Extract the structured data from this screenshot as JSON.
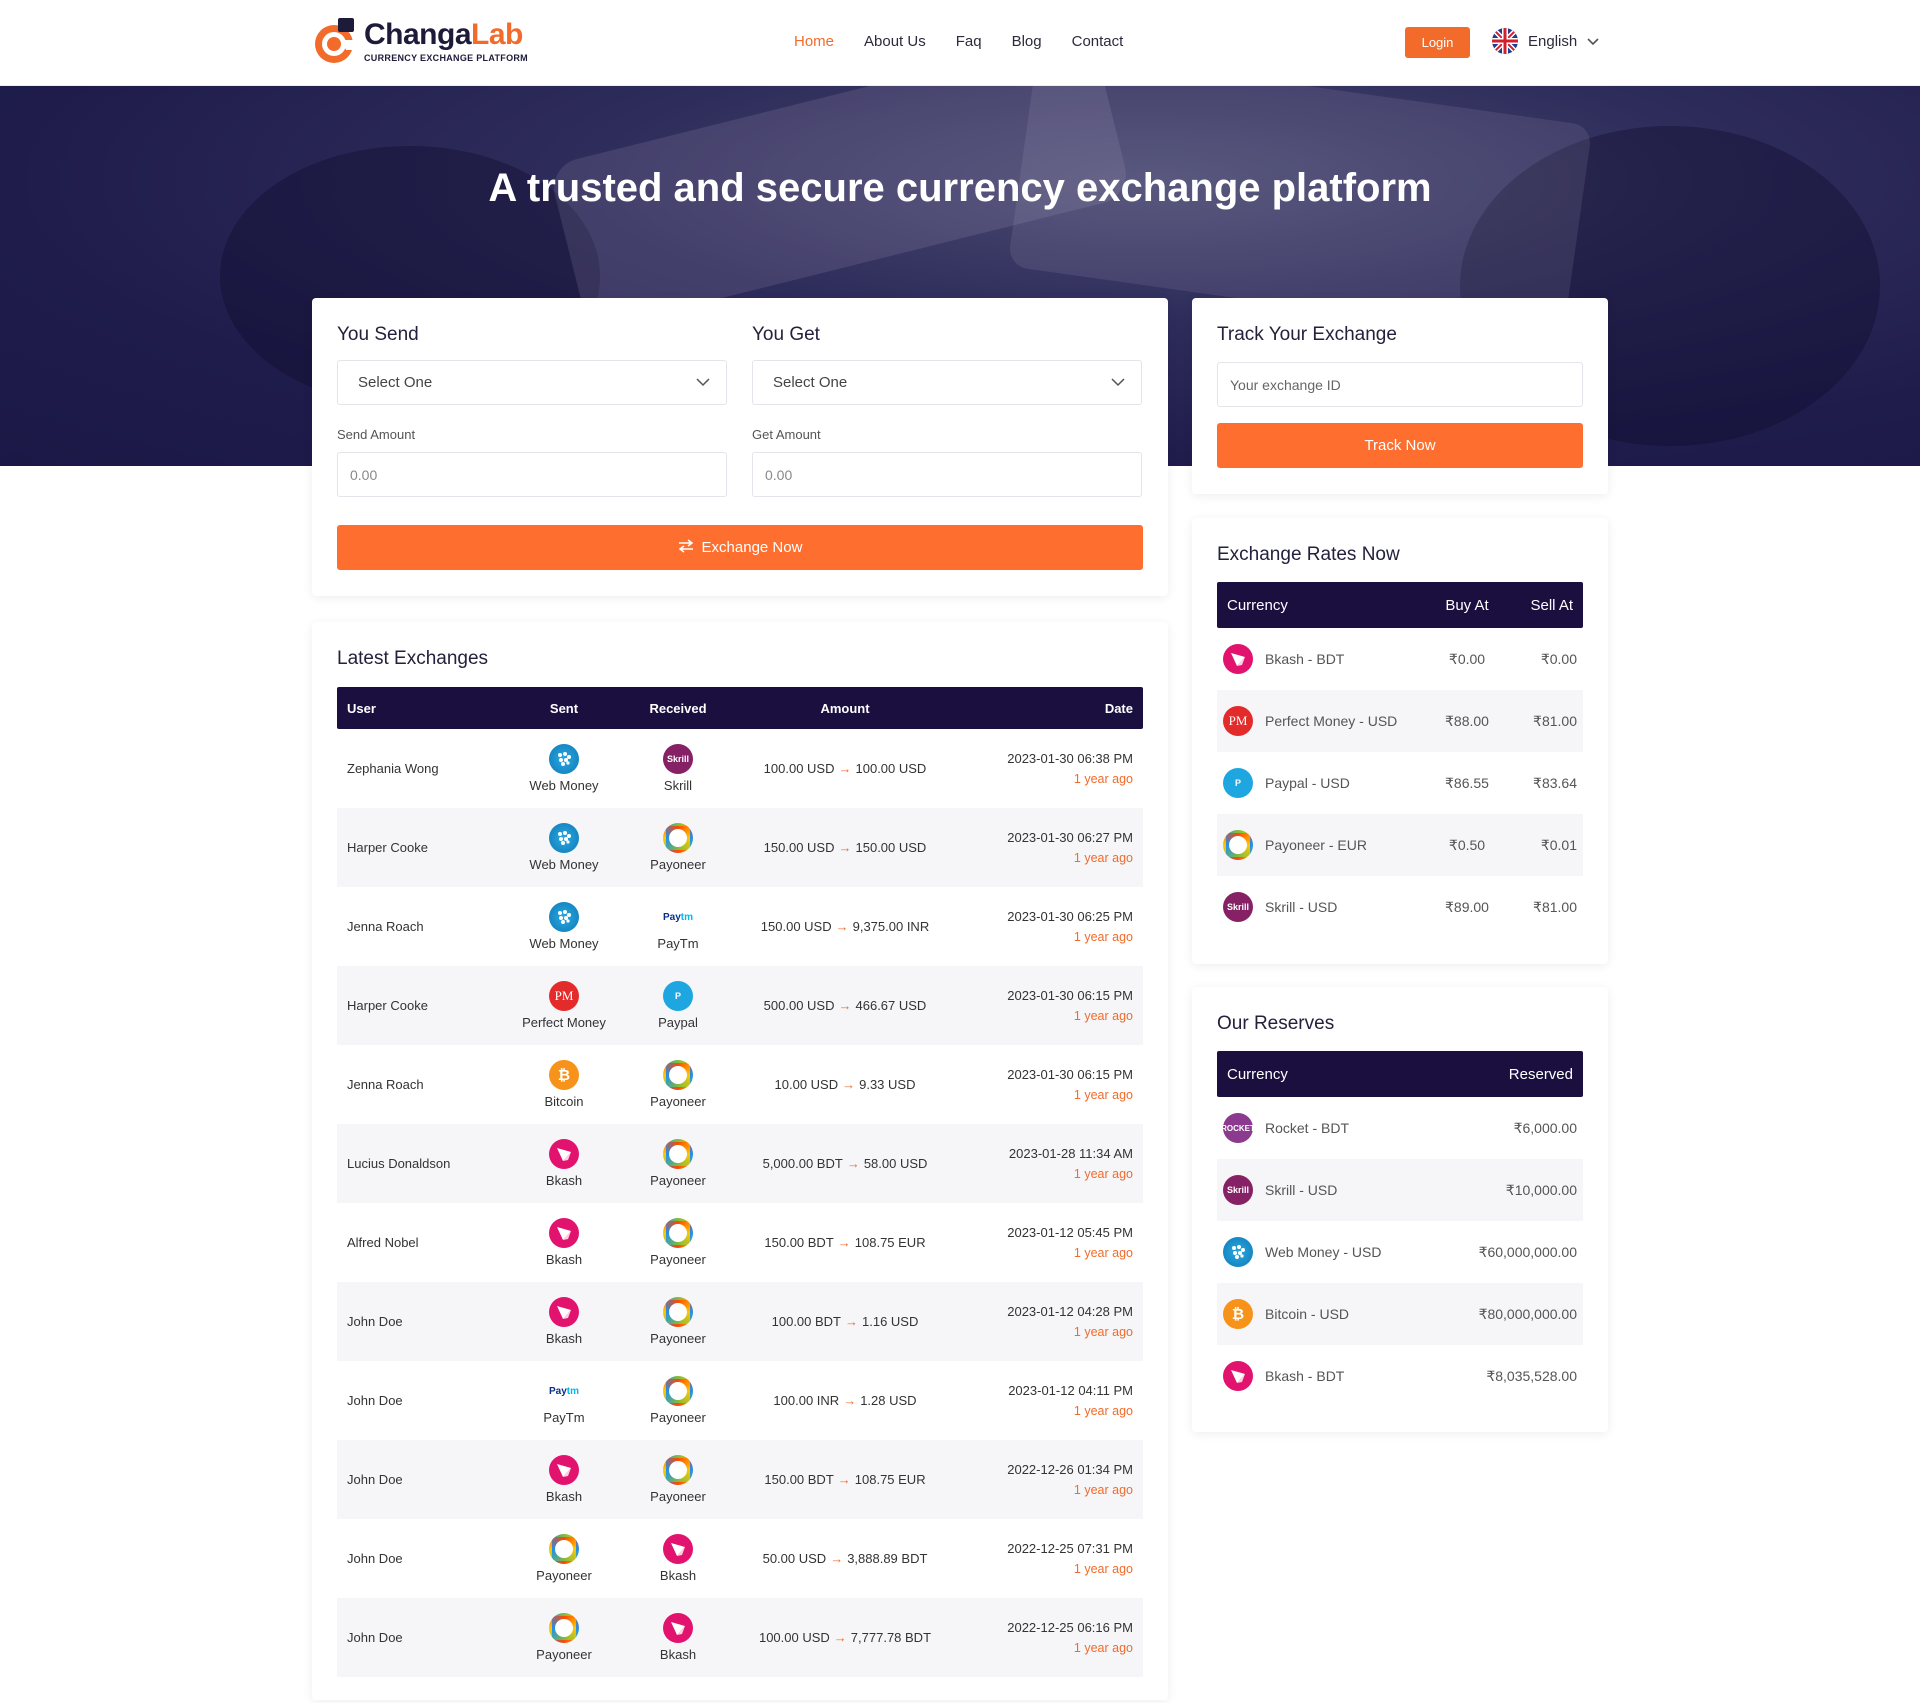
{
  "header": {
    "logo_name_1": "Changa",
    "logo_name_2": "Lab",
    "logo_tagline": "CURRENCY EXCHANGE PLATFORM",
    "nav": [
      "Home",
      "About Us",
      "Faq",
      "Blog",
      "Contact"
    ],
    "login_label": "Login",
    "language": "English"
  },
  "hero": {
    "title": "A trusted and secure currency exchange platform"
  },
  "exchange_form": {
    "send_title": "You Send",
    "get_title": "You Get",
    "send_select": "Select One",
    "get_select": "Select One",
    "send_amount_label": "Send Amount",
    "get_amount_label": "Get Amount",
    "send_amount_placeholder": "0.00",
    "get_amount_placeholder": "0.00",
    "button_label": "Exchange Now"
  },
  "track": {
    "title": "Track Your Exchange",
    "placeholder": "Your exchange ID",
    "button_label": "Track Now"
  },
  "rates": {
    "title": "Exchange Rates Now",
    "headers": [
      "Currency",
      "Buy At",
      "Sell At"
    ],
    "rows": [
      {
        "icon": "bkash-icon",
        "currency": "Bkash - BDT",
        "buy": "₹0.00",
        "sell": "₹0.00"
      },
      {
        "icon": "perfect-money-icon",
        "currency": "Perfect Money - USD",
        "buy": "₹88.00",
        "sell": "₹81.00"
      },
      {
        "icon": "paypal-icon",
        "currency": "Paypal - USD",
        "buy": "₹86.55",
        "sell": "₹83.64"
      },
      {
        "icon": "payoneer-icon",
        "currency": "Payoneer - EUR",
        "buy": "₹0.50",
        "sell": "₹0.01"
      },
      {
        "icon": "skrill-icon",
        "currency": "Skrill - USD",
        "buy": "₹89.00",
        "sell": "₹81.00"
      }
    ]
  },
  "reserves": {
    "title": "Our Reserves",
    "headers": [
      "Currency",
      "Reserved"
    ],
    "rows": [
      {
        "icon": "rocket-icon",
        "currency": "Rocket - BDT",
        "amount": "₹6,000.00"
      },
      {
        "icon": "skrill-icon",
        "currency": "Skrill - USD",
        "amount": "₹10,000.00"
      },
      {
        "icon": "webmoney-icon",
        "currency": "Web Money - USD",
        "amount": "₹60,000,000.00"
      },
      {
        "icon": "bitcoin-icon",
        "currency": "Bitcoin - USD",
        "amount": "₹80,000,000.00"
      },
      {
        "icon": "bkash-icon",
        "currency": "Bkash - BDT",
        "amount": "₹8,035,528.00"
      }
    ]
  },
  "latest": {
    "title": "Latest Exchanges",
    "headers": [
      "User",
      "Sent",
      "Received",
      "Amount",
      "Date"
    ],
    "rows": [
      {
        "user": "Zephania Wong",
        "sent": "Web Money",
        "sent_icon": "webmoney",
        "received": "Skrill",
        "received_icon": "skrill",
        "from": "100.00 USD",
        "to": "100.00 USD",
        "date": "2023-01-30 06:38 PM",
        "ago": "1 year ago"
      },
      {
        "user": "Harper Cooke",
        "sent": "Web Money",
        "sent_icon": "webmoney",
        "received": "Payoneer",
        "received_icon": "payoneer",
        "from": "150.00 USD",
        "to": "150.00 USD",
        "date": "2023-01-30 06:27 PM",
        "ago": "1 year ago"
      },
      {
        "user": "Jenna Roach",
        "sent": "Web Money",
        "sent_icon": "webmoney",
        "received": "PayTm",
        "received_icon": "paytm",
        "from": "150.00 USD",
        "to": "9,375.00 INR",
        "date": "2023-01-30 06:25 PM",
        "ago": "1 year ago"
      },
      {
        "user": "Harper Cooke",
        "sent": "Perfect Money",
        "sent_icon": "pm",
        "received": "Paypal",
        "received_icon": "paypal",
        "from": "500.00 USD",
        "to": "466.67 USD",
        "date": "2023-01-30 06:15 PM",
        "ago": "1 year ago"
      },
      {
        "user": "Jenna Roach",
        "sent": "Bitcoin",
        "sent_icon": "bitcoin",
        "received": "Payoneer",
        "received_icon": "payoneer",
        "from": "10.00 USD",
        "to": "9.33 USD",
        "date": "2023-01-30 06:15 PM",
        "ago": "1 year ago"
      },
      {
        "user": "Lucius Donaldson",
        "sent": "Bkash",
        "sent_icon": "bkash",
        "received": "Payoneer",
        "received_icon": "payoneer",
        "from": "5,000.00 BDT",
        "to": "58.00 USD",
        "date": "2023-01-28 11:34 AM",
        "ago": "1 year ago"
      },
      {
        "user": "Alfred Nobel",
        "sent": "Bkash",
        "sent_icon": "bkash",
        "received": "Payoneer",
        "received_icon": "payoneer",
        "from": "150.00 BDT",
        "to": "108.75 EUR",
        "date": "2023-01-12 05:45 PM",
        "ago": "1 year ago"
      },
      {
        "user": "John Doe",
        "sent": "Bkash",
        "sent_icon": "bkash",
        "received": "Payoneer",
        "received_icon": "payoneer",
        "from": "100.00 BDT",
        "to": "1.16 USD",
        "date": "2023-01-12 04:28 PM",
        "ago": "1 year ago"
      },
      {
        "user": "John Doe",
        "sent": "PayTm",
        "sent_icon": "paytm",
        "received": "Payoneer",
        "received_icon": "payoneer",
        "from": "100.00 INR",
        "to": "1.28 USD",
        "date": "2023-01-12 04:11 PM",
        "ago": "1 year ago"
      },
      {
        "user": "John Doe",
        "sent": "Bkash",
        "sent_icon": "bkash",
        "received": "Payoneer",
        "received_icon": "payoneer",
        "from": "150.00 BDT",
        "to": "108.75 EUR",
        "date": "2022-12-26 01:34 PM",
        "ago": "1 year ago"
      },
      {
        "user": "John Doe",
        "sent": "Payoneer",
        "sent_icon": "payoneer",
        "received": "Bkash",
        "received_icon": "bkash",
        "from": "50.00 USD",
        "to": "3,888.89 BDT",
        "date": "2022-12-25 07:31 PM",
        "ago": "1 year ago"
      },
      {
        "user": "John Doe",
        "sent": "Payoneer",
        "sent_icon": "payoneer",
        "received": "Bkash",
        "received_icon": "bkash",
        "from": "100.00 USD",
        "to": "7,777.78 BDT",
        "date": "2022-12-25 06:16 PM",
        "ago": "1 year ago"
      }
    ]
  },
  "colors": {
    "accent": "#fe6f2f",
    "dark": "#1a0f3f",
    "hero": "#2e2c5a"
  }
}
